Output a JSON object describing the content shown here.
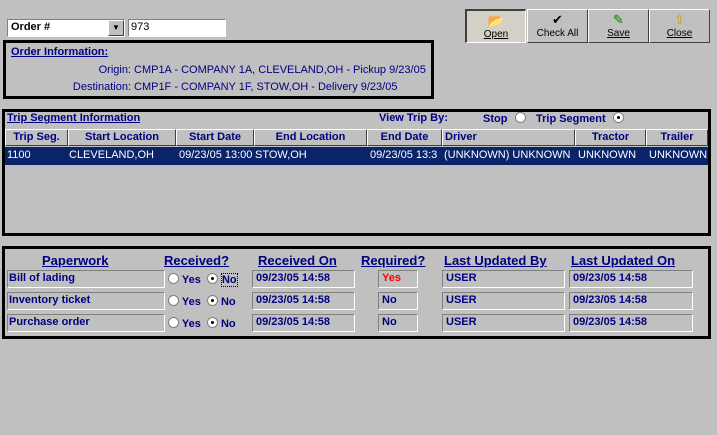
{
  "search": {
    "field_label": "Order #",
    "value": "973",
    "dropdown_icon": "triangle-down"
  },
  "toolbar": {
    "open": "Open",
    "check_all": "Check All",
    "save": "Save",
    "close": "Close"
  },
  "order_info": {
    "title": "Order Information:",
    "origin_label": "Origin:",
    "origin_value": "CMP1A - COMPANY 1A, CLEVELAND,OH - Pickup 9/23/05",
    "destination_label": "Destination:",
    "destination_value": "CMP1F - COMPANY 1F, STOW,OH -  Delivery 9/23/05"
  },
  "trip": {
    "title": "Trip Segment Information",
    "view_by_label": "View Trip By:",
    "options": [
      "Stop",
      "Trip Segment"
    ],
    "selected": "Trip Segment",
    "columns": [
      "Trip Seg.",
      "Start Location",
      "Start Date",
      "End Location",
      "End Date",
      "Driver",
      "Tractor",
      "Trailer"
    ],
    "rows": [
      [
        "1100",
        "CLEVELAND,OH",
        "09/23/05 13:00",
        "STOW,OH",
        "09/23/05 13:3",
        "(UNKNOWN) UNKNOWN",
        "UNKNOWN",
        "UNKNOWN"
      ]
    ]
  },
  "paperwork": {
    "headers": [
      "Paperwork",
      "Received?",
      "Received On",
      "Required?",
      "Last Updated By",
      "Last Updated On"
    ],
    "yes_label": "Yes",
    "no_label": "No",
    "rows": [
      {
        "name": "Bill of lading",
        "received": "No",
        "received_on": "09/23/05 14:58",
        "required": "Yes",
        "updated_by": "USER",
        "updated_on": "09/23/05 14:58"
      },
      {
        "name": "Inventory ticket",
        "received": "No",
        "received_on": "09/23/05 14:58",
        "required": "No",
        "updated_by": "USER",
        "updated_on": "09/23/05 14:58"
      },
      {
        "name": "Purchase order",
        "received": "No",
        "received_on": "09/23/05 14:58",
        "required": "No",
        "updated_by": "USER",
        "updated_on": "09/23/05 14:58"
      }
    ]
  },
  "colors": {
    "accent": "#000080",
    "selection": "#0a246a",
    "required_yes": "#ff0000"
  }
}
